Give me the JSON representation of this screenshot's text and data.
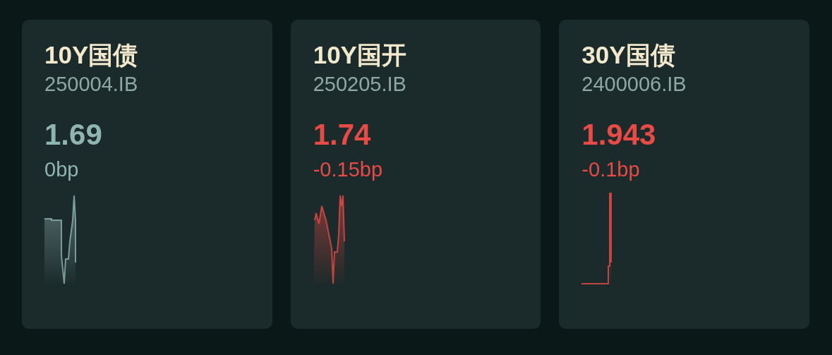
{
  "quotes": [
    {
      "name": "10Y国债",
      "code": "250004.IB",
      "value": "1.69",
      "change": "0bp",
      "color": "#8fb5b0"
    },
    {
      "name": "10Y国开",
      "code": "250205.IB",
      "value": "1.74",
      "change": "-0.15bp",
      "color": "#e84a45"
    },
    {
      "name": "30Y国债",
      "code": "2400006.IB",
      "value": "1.943",
      "change": "-0.1bp",
      "color": "#e84a45"
    }
  ]
}
